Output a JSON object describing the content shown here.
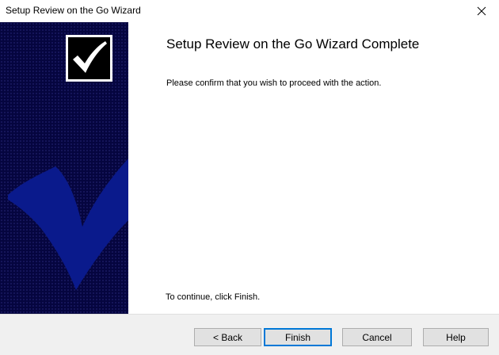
{
  "window": {
    "title": "Setup Review on the Go Wizard"
  },
  "content": {
    "heading": "Setup Review on the Go Wizard Complete",
    "description": "Please confirm that you wish to proceed with the action.",
    "continue_text": "To continue, click Finish."
  },
  "buttons": {
    "back_label": "< Back",
    "finish_label": "Finish",
    "cancel_label": "Cancel",
    "help_label": "Help"
  },
  "icons": {
    "close": "close-icon",
    "checkmark": "checkmark-icon",
    "banner_swoosh": "banner-checkmark-graphic"
  },
  "colors": {
    "banner_background": "#05053f",
    "banner_swoosh": "#0a1a8c",
    "default_button_border": "#0078d7",
    "button_bar": "#f0f0f0"
  }
}
